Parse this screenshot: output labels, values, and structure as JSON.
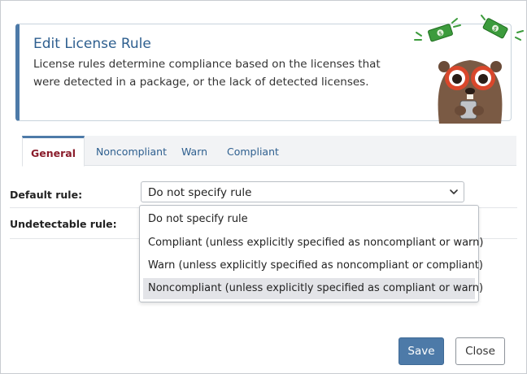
{
  "header": {
    "title": "Edit License Rule",
    "description": "License rules determine compliance based on the licenses that were detected in a package, or the lack of detected licenses."
  },
  "mascot": {
    "icon": "beaver-mascot-with-money-icon"
  },
  "tabs": [
    {
      "label": "General",
      "active": true
    },
    {
      "label": "Noncompliant",
      "active": false
    },
    {
      "label": "Warn",
      "active": false
    },
    {
      "label": "Compliant",
      "active": false
    }
  ],
  "form": {
    "default_rule_label": "Default rule:",
    "undetectable_rule_label": "Undetectable rule:",
    "default_rule_value": "Do not specify rule"
  },
  "dropdown": {
    "options": [
      "Do not specify rule",
      "Compliant (unless explicitly specified as noncompliant or warn)",
      "Warn (unless explicitly specified as noncompliant or compliant)",
      "Noncompliant (unless explicitly specified as compliant or warn)"
    ],
    "highlighted_index": 3
  },
  "buttons": {
    "save": "Save",
    "close": "Close"
  },
  "colors": {
    "accent": "#4d7aa8",
    "active_tab_text": "#8a1c2b",
    "title_text": "#2e5f8f"
  }
}
